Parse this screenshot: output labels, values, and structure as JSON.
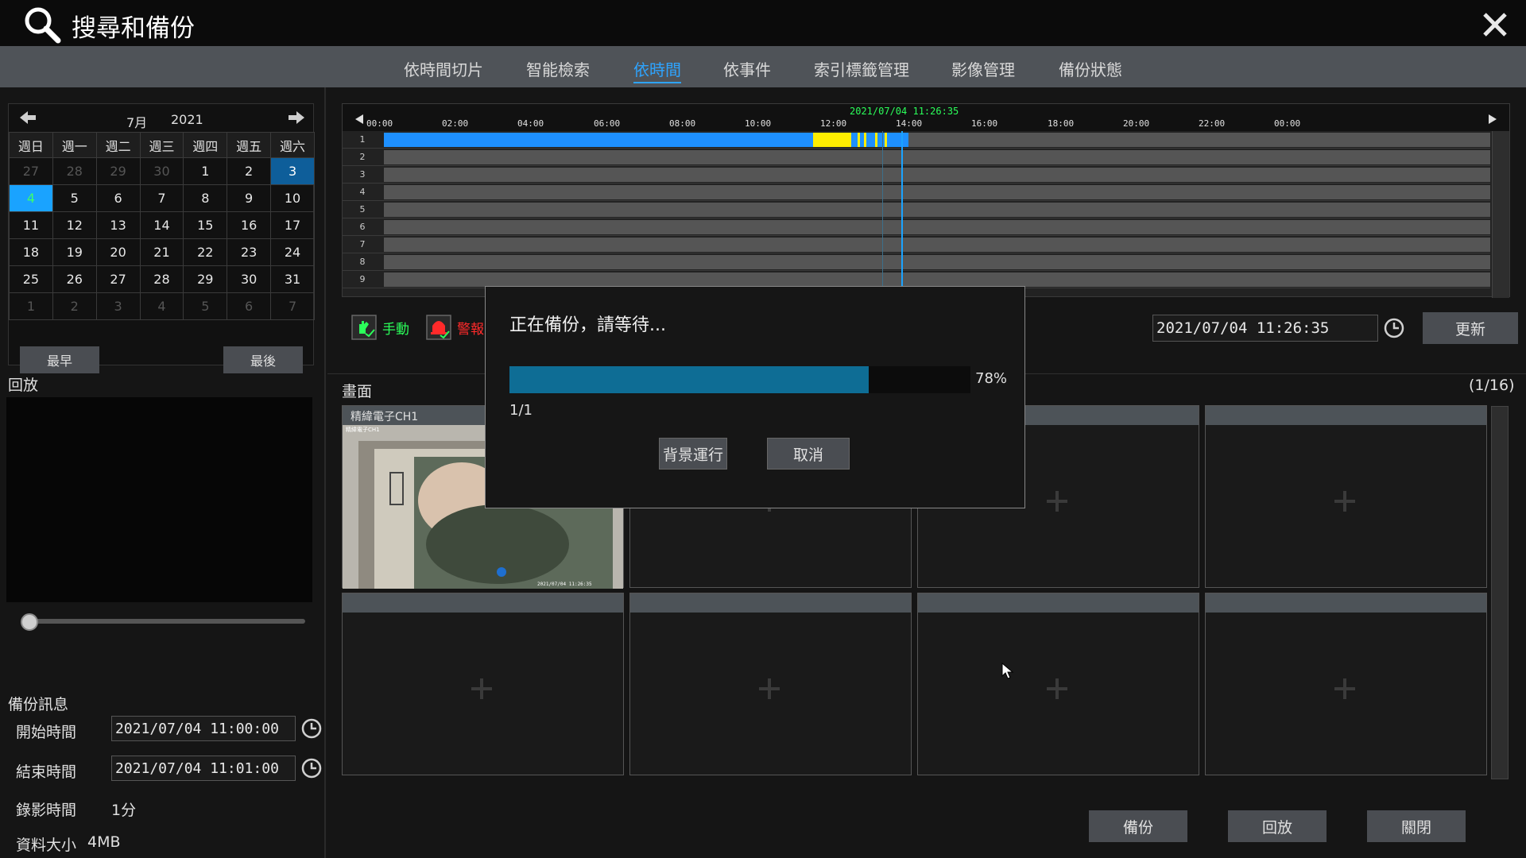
{
  "window": {
    "title": "搜尋和備份"
  },
  "tabs": [
    {
      "label": "依時間切片"
    },
    {
      "label": "智能檢索"
    },
    {
      "label": "依時間"
    },
    {
      "label": "依事件"
    },
    {
      "label": "索引標籤管理"
    },
    {
      "label": "影像管理"
    },
    {
      "label": "備份狀態"
    }
  ],
  "active_tab": "依時間",
  "calendar": {
    "month": "7月",
    "year": "2021",
    "weekdays": [
      "週日",
      "週一",
      "週二",
      "週三",
      "週四",
      "週五",
      "週六"
    ],
    "weeks": [
      [
        "27",
        "28",
        "29",
        "30",
        "1",
        "2",
        "3"
      ],
      [
        "4",
        "5",
        "6",
        "7",
        "8",
        "9",
        "10"
      ],
      [
        "11",
        "12",
        "13",
        "14",
        "15",
        "16",
        "17"
      ],
      [
        "18",
        "19",
        "20",
        "21",
        "22",
        "23",
        "24"
      ],
      [
        "25",
        "26",
        "27",
        "28",
        "29",
        "30",
        "31"
      ],
      [
        "1",
        "2",
        "3",
        "4",
        "5",
        "6",
        "7"
      ]
    ],
    "earliest_label": "最早",
    "latest_label": "最後"
  },
  "playback": {
    "label": "回放",
    "position": 0.0
  },
  "backup_info": {
    "section_label": "備份訊息",
    "start_label": "開始時間",
    "start_value": "2021/07/04 11:00:00",
    "end_label": "結束時間",
    "end_value": "2021/07/04 11:01:00",
    "duration_label": "錄影時間",
    "duration_value": "1分",
    "size_label": "資料大小",
    "size_value": "4MB"
  },
  "timeline": {
    "current_time_label": "2021/07/04 11:26:35",
    "ticks": [
      "00:00",
      "02:00",
      "04:00",
      "06:00",
      "08:00",
      "10:00",
      "12:00",
      "14:00",
      "16:00",
      "18:00",
      "20:00",
      "22:00",
      "00:00"
    ],
    "rows": [
      "1",
      "2",
      "3",
      "4",
      "5",
      "6",
      "7",
      "8",
      "9"
    ],
    "colors": {
      "manual": "#1e90ff",
      "event": "#ffee00",
      "marker": "#1aa3ff"
    }
  },
  "legend": {
    "manual_label": "手動",
    "manual_color": "#2bff5a",
    "alarm_label": "警報",
    "alarm_color": "#ff2a2a"
  },
  "time_field": {
    "value": "2021/07/04 11:26:35"
  },
  "update_label": "更新",
  "channels": {
    "section_label": "畫面",
    "page_indicator": "(1/16)",
    "items": [
      {
        "name": "精緯電子CH1"
      },
      {
        "name": ""
      },
      {
        "name": ""
      },
      {
        "name": ""
      },
      {
        "name": ""
      },
      {
        "name": ""
      },
      {
        "name": ""
      },
      {
        "name": ""
      }
    ],
    "cam_overlay": "精緯電子CH1",
    "cam_timestamp": "2021/07/04 11:26:35"
  },
  "actions": {
    "backup": "備份",
    "playback": "回放",
    "close": "關閉"
  },
  "dialog": {
    "title": "正在備份，請等待...",
    "progress": 0.78,
    "progress_label": "78%",
    "count": "1/1",
    "background_label": "背景運行",
    "cancel_label": "取消"
  }
}
